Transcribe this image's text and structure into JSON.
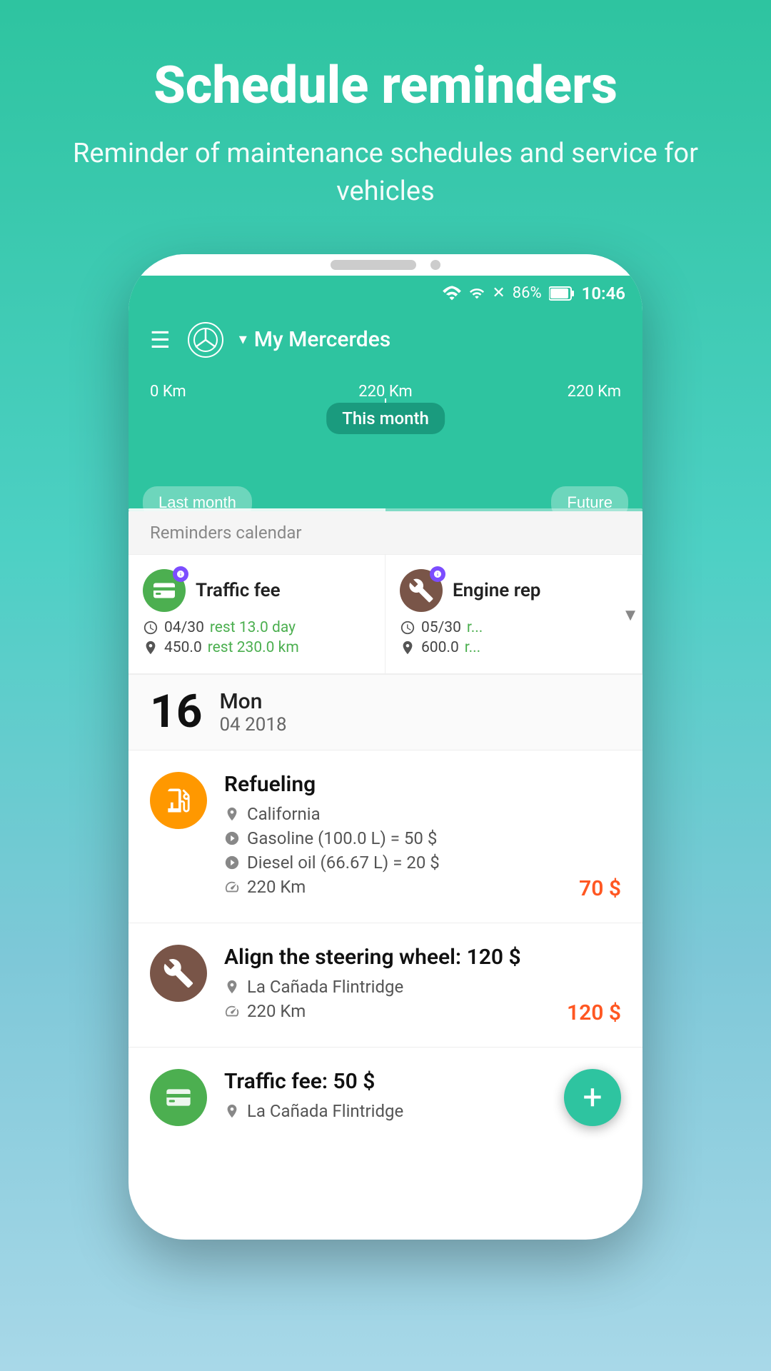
{
  "page": {
    "title": "Schedule reminders",
    "subtitle": "Reminder of maintenance schedules and service for vehicles"
  },
  "status_bar": {
    "battery": "86%",
    "time": "10:46"
  },
  "app_header": {
    "vehicle_name": "My Mercerdes"
  },
  "timeline": {
    "left_km": "0 Km",
    "center_km": "220 Km",
    "right_km": "220 Km",
    "this_month_label": "This month",
    "last_month_label": "Last month",
    "future_label": "Future"
  },
  "reminders_section": {
    "header": "Reminders calendar",
    "cards": [
      {
        "title": "Traffic fee",
        "date": "04/30",
        "rest_days": "rest 13.0 day",
        "km": "450.0",
        "rest_km": "rest 230.0 km",
        "icon_color": "green",
        "icon_type": "card"
      },
      {
        "title": "Engine rep",
        "date": "05/30",
        "rest_days": "r...",
        "km": "600.0",
        "rest_km": "r...",
        "icon_color": "brown",
        "icon_type": "wrench"
      }
    ]
  },
  "date_separator": {
    "day_number": "16",
    "day_name": "Mon",
    "month_year": "04 2018"
  },
  "activities": [
    {
      "title": "Refueling",
      "icon_color": "orange",
      "icon_type": "fuel",
      "location": "California",
      "details": [
        "Gasoline (100.0 L) = 50 $",
        "Diesel oil (66.67 L) = 20 $",
        "220 Km"
      ],
      "amount": "70 $"
    },
    {
      "title": "Align the steering wheel: 120 $",
      "icon_color": "brown",
      "icon_type": "wrench",
      "location": "La Cañada Flintridge",
      "details": [
        "220 Km"
      ],
      "amount": "120 $"
    },
    {
      "title": "Traffic fee: 50 $",
      "icon_color": "green",
      "icon_type": "card",
      "location": "La Cañada Flintridge",
      "details": [],
      "amount": ""
    }
  ],
  "fab": {
    "label": "+"
  }
}
